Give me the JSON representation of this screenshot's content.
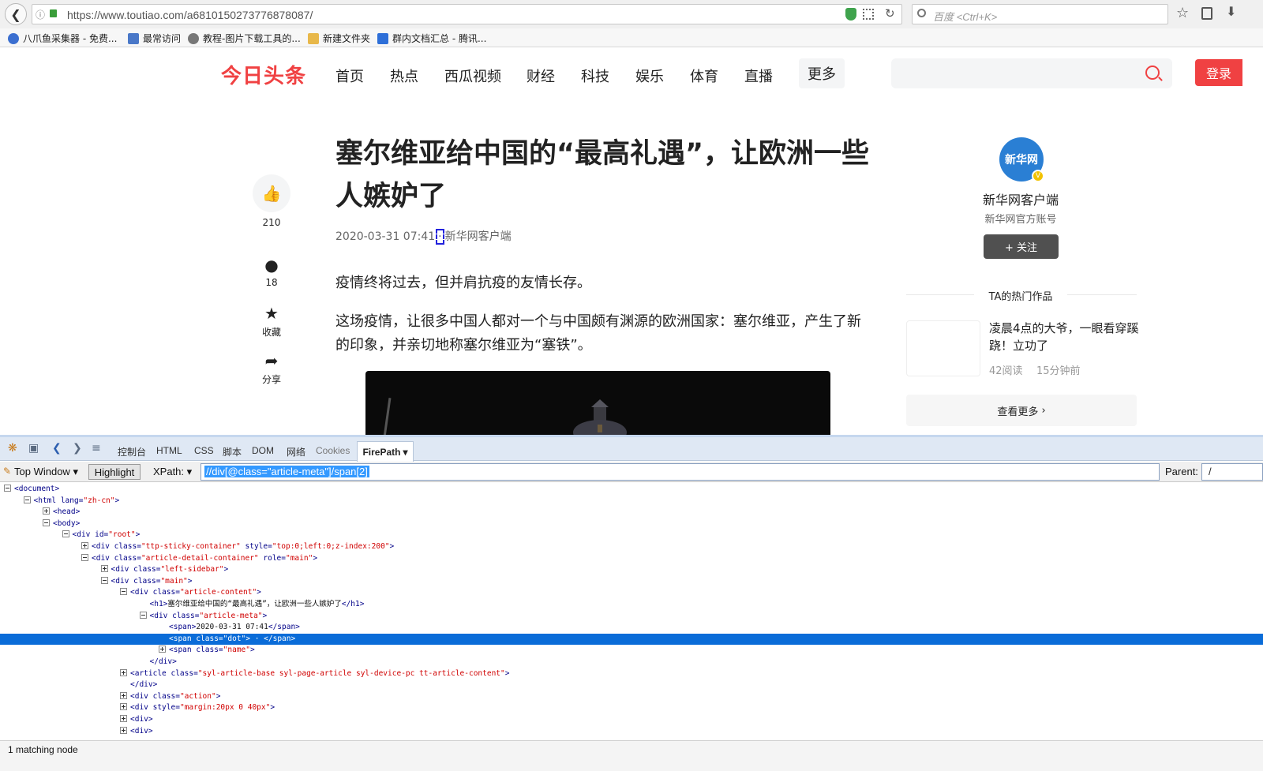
{
  "browser": {
    "url": "https://www.toutiao.com/a6810150273776878087/",
    "search_placeholder": "百度 <Ctrl+K>",
    "bookmarks": [
      {
        "label": "八爪鱼采集器 - 免费...",
        "color": "#3b6fd0"
      },
      {
        "label": "最常访问",
        "color": "#4a78c8"
      },
      {
        "label": "教程-图片下载工具的...",
        "color": "#777777"
      },
      {
        "label": "新建文件夹",
        "color": "#e8b84a"
      },
      {
        "label": "群内文档汇总 - 腾讯...",
        "color": "#2e6fd8"
      }
    ]
  },
  "site": {
    "logo": "今日头条",
    "brand_color": "#f04142",
    "nav": [
      "首页",
      "热点",
      "西瓜视频",
      "财经",
      "科技",
      "娱乐",
      "体育",
      "直播"
    ],
    "nav_more": "更多",
    "login": "登录"
  },
  "actions": {
    "likes": "210",
    "comments": "18",
    "collect": "收藏",
    "share": "分享"
  },
  "article": {
    "title": "塞尔维亚给中国的“最高礼遇”，让欧洲一些人嫉妒了",
    "date": "2020-03-31 07:41",
    "dot": "·",
    "source": "新华网客户端",
    "paragraphs": [
      "疫情终将过去，但并肩抗疫的友情长存。",
      "这场疫情，让很多中国人都对一个与中国颇有渊源的欧洲国家：塞尔维亚，产生了新的印象，并亲切地称塞尔维亚为“塞铁”。"
    ]
  },
  "author": {
    "avatar_text": "新华网",
    "name": "新华网客户端",
    "desc": "新华网官方账号",
    "follow": "+ 关注",
    "hot_title": "TA的热门作品",
    "hot_items": [
      {
        "title": "凌晨4点的大爷，一眼看穿蹊跷！立功了",
        "reads": "42阅读",
        "time": "15分钟前"
      }
    ],
    "see_more": "查看更多"
  },
  "devtools": {
    "tabs": [
      "控制台",
      "HTML",
      "CSS",
      "脚本",
      "DOM",
      "网络",
      "Cookies"
    ],
    "active_tab": "FirePath",
    "window": "Top Window",
    "highlight": "Highlight",
    "xpath_label": "XPath:",
    "xpath": "//div[@class=\"article-meta\"]/span[2]",
    "parent_label": "Parent:",
    "parent": "/",
    "status": "1 matching node",
    "tree": [
      {
        "depth": 0,
        "exp": "minus",
        "html": "<document>"
      },
      {
        "depth": 1,
        "exp": "minus",
        "tag": "html",
        "attrs": [
          [
            "lang",
            "zh-cn"
          ]
        ]
      },
      {
        "depth": 2,
        "exp": "plus",
        "tag": "head",
        "attrs": []
      },
      {
        "depth": 2,
        "exp": "minus",
        "tag": "body",
        "attrs": []
      },
      {
        "depth": 3,
        "exp": "minus",
        "tag": "div",
        "attrs": [
          [
            "id",
            "root"
          ]
        ]
      },
      {
        "depth": 4,
        "exp": "plus",
        "tag": "div",
        "attrs": [
          [
            "class",
            "ttp-sticky-container"
          ],
          [
            "style",
            "top:0;left:0;z-index:200"
          ]
        ]
      },
      {
        "depth": 4,
        "exp": "minus",
        "tag": "div",
        "attrs": [
          [
            "class",
            "article-detail-container"
          ],
          [
            "role",
            "main"
          ]
        ]
      },
      {
        "depth": 5,
        "exp": "plus",
        "tag": "div",
        "attrs": [
          [
            "class",
            "left-sidebar"
          ]
        ]
      },
      {
        "depth": 5,
        "exp": "minus",
        "tag": "div",
        "attrs": [
          [
            "class",
            "main"
          ]
        ]
      },
      {
        "depth": 6,
        "exp": "minus",
        "tag": "div",
        "attrs": [
          [
            "class",
            "article-content"
          ]
        ]
      },
      {
        "depth": 7,
        "exp": "none",
        "tag": "h1",
        "attrs": [],
        "text": "塞尔维亚给中国的“最高礼遇”，让欧洲一些人嫉妒了",
        "close": "h1"
      },
      {
        "depth": 7,
        "exp": "minus",
        "tag": "div",
        "attrs": [
          [
            "class",
            "article-meta"
          ]
        ]
      },
      {
        "depth": 8,
        "exp": "none",
        "tag": "span",
        "attrs": [],
        "text": "2020-03-31  07:41",
        "close": "span"
      },
      {
        "depth": 8,
        "exp": "none",
        "tag": "span",
        "attrs": [
          [
            "class",
            "dot"
          ]
        ],
        "text": " · ",
        "close": "span",
        "selected": true
      },
      {
        "depth": 8,
        "exp": "plus",
        "tag": "span",
        "attrs": [
          [
            "class",
            "name"
          ]
        ]
      },
      {
        "depth": 7,
        "exp": "none",
        "endtag": "div"
      },
      {
        "depth": 6,
        "exp": "plus",
        "tag": "article",
        "attrs": [
          [
            "class",
            "syl-article-base syl-page-article syl-device-pc tt-article-content"
          ]
        ]
      },
      {
        "depth": 6,
        "exp": "none",
        "endtag": "div"
      },
      {
        "depth": 6,
        "exp": "plus",
        "tag": "div",
        "attrs": [
          [
            "class",
            "action"
          ]
        ]
      },
      {
        "depth": 6,
        "exp": "plus",
        "tag": "div",
        "attrs": [
          [
            "style",
            "margin:20px 0 40px"
          ]
        ]
      },
      {
        "depth": 6,
        "exp": "plus",
        "tag": "div",
        "attrs": []
      },
      {
        "depth": 6,
        "exp": "plus",
        "tag": "div",
        "attrs": []
      }
    ]
  }
}
